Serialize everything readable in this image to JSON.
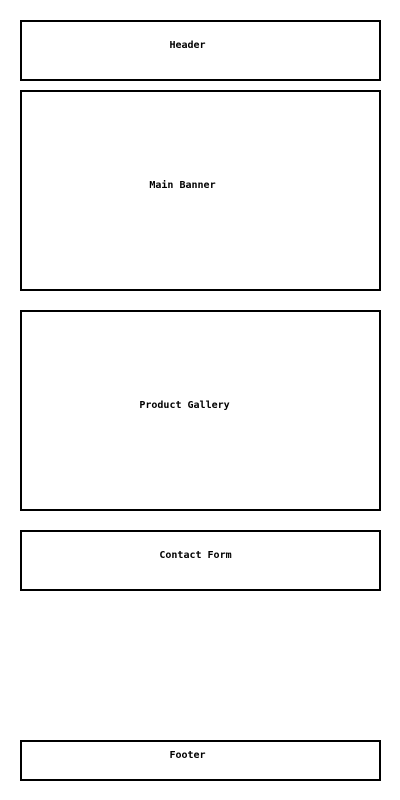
{
  "sections": {
    "header": "Header",
    "banner": "Main Banner",
    "gallery": "Product Gallery",
    "contact": "Contact Form",
    "footer": "Footer"
  }
}
